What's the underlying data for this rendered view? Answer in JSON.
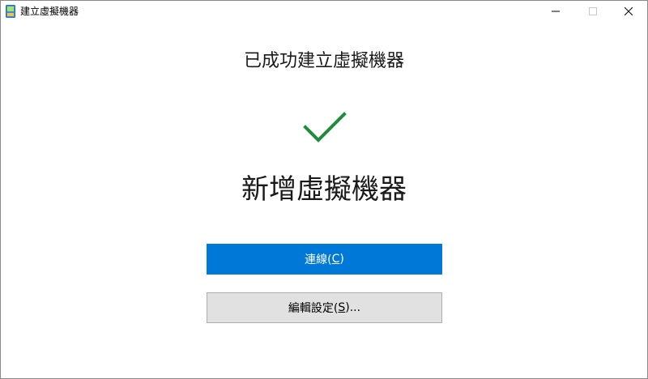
{
  "window": {
    "title": "建立虛擬機器",
    "controls": {
      "minimize_icon": "minimize-icon",
      "maximize_icon": "maximize-icon",
      "close_icon": "close-icon"
    }
  },
  "main": {
    "heading": "已成功建立虛擬機器",
    "status_icon": "checkmark-icon",
    "vm_name": "新增虛擬機器",
    "connect_button": {
      "label_prefix": "連線(",
      "mnemonic": "C",
      "label_suffix": ")"
    },
    "edit_settings_button": {
      "label_prefix": "編輯設定(",
      "mnemonic": "S",
      "label_suffix": ")..."
    }
  },
  "colors": {
    "accent": "#0078d7",
    "check": "#1e8c3a",
    "secondary_button": "#e1e1e1"
  }
}
